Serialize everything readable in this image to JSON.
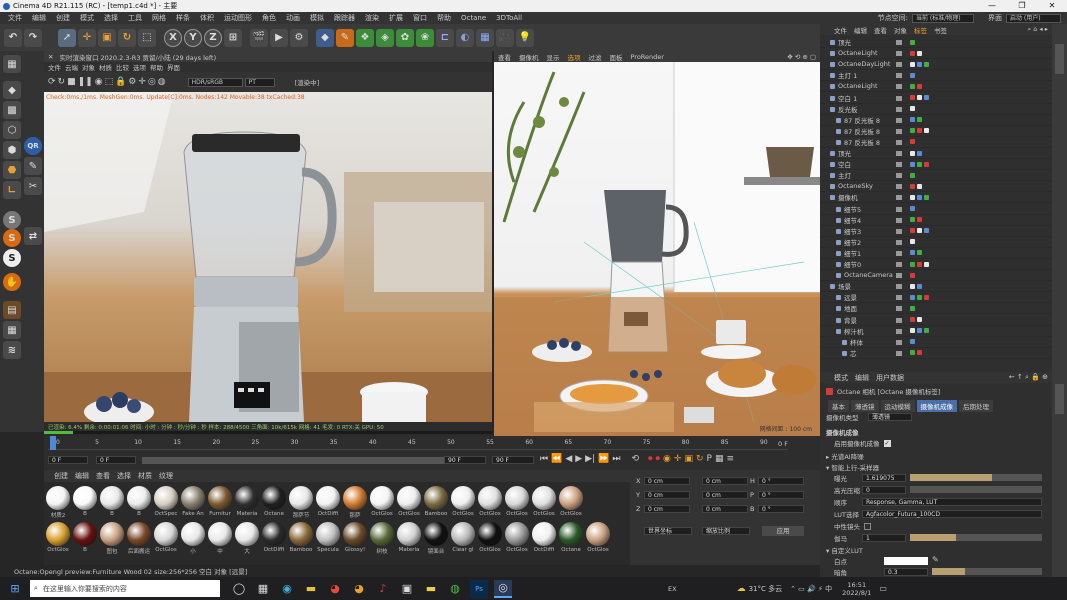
{
  "window": {
    "title": "Cinema 4D R21.115 (RC) - [temp1.c4d *] - 主要"
  },
  "menu": {
    "items": [
      "文件",
      "编辑",
      "创建",
      "模式",
      "选择",
      "工具",
      "网格",
      "样条",
      "体积",
      "运动图形",
      "角色",
      "动画",
      "模拟",
      "跟踪器",
      "渲染",
      "扩展",
      "窗口",
      "帮助",
      "Octane",
      "3DToAll"
    ],
    "node_space_label": "节点空间:",
    "node_space_value": "当前 (标准/物理)",
    "interface_label": "界面",
    "interface_value": "启动 (用户)"
  },
  "toolbar": {
    "axis_x": "X",
    "axis_y": "Y",
    "axis_z": "Z"
  },
  "left_tools": {
    "qr": "QR"
  },
  "live_viewer": {
    "title": "实时渲染窗口 2020.2.3-R3 贾留/小陆 (29 days left)",
    "menus": [
      "文件",
      "云端",
      "对象",
      "材质",
      "比较",
      "选项",
      "帮助",
      "界面"
    ],
    "colorspace": "HDR/sRGB",
    "mode": "PT",
    "status_tag": "[渲染中]",
    "info_line": "Check:0ms./1ms. MeshGen:0ms. Update[C]:0ms. Nodes:142 Movable:38 txCached:38",
    "stats_line": "已渲染: 6.4%  剩余: 0:00:01:06  时间: 小时 : 分钟 : 秒/分钟 : 秒  样本: 288/4500  三角面: 10k/615k  网格: 41  毛发: 0  RTX:关  GPU: 50",
    "progress": 0.064
  },
  "editor_viewport": {
    "menus": [
      "查看",
      "摄像机",
      "显示",
      "选项",
      "过滤",
      "面板",
      "ProRender"
    ],
    "grid_info": "网格间距 : 100 cm"
  },
  "timeline": {
    "ticks": [
      "0",
      "5",
      "10",
      "15",
      "20",
      "25",
      "30",
      "35",
      "40",
      "45",
      "50",
      "55",
      "60",
      "65",
      "70",
      "75",
      "80",
      "85",
      "90"
    ],
    "end_label": "0 F",
    "current_frame": "0 F",
    "start_field": "0 F",
    "end_field": "90 F",
    "end_field2": "90 F"
  },
  "material_manager": {
    "menus": [
      "创建",
      "编辑",
      "查看",
      "选择",
      "材质",
      "纹理"
    ],
    "row1": [
      "材质2",
      "B",
      "B",
      "B",
      "OctSpec",
      "Fake An",
      "Furnitur",
      "Materia",
      "Octane",
      "那萨节",
      "OctDiffi",
      "那萨",
      "OctGlos",
      "OctGlos",
      "Bamboo",
      "OctGlos",
      "OctGlos",
      "OctGlos",
      "OctGlos",
      "OctGlos"
    ],
    "row2": [
      "OctGlos",
      "B",
      "图包",
      "后面搬运",
      "OctGlos",
      "小",
      "中",
      "大",
      "OctDiffi",
      "Bamboo",
      "Specula",
      "Glossy!",
      "树枝",
      "Materia",
      "镜面台",
      "Clear gl",
      "OctGlos",
      "OctGlos",
      "OctDiffi",
      "Octane",
      "OctGlos"
    ]
  },
  "coordinates": {
    "x": "0 cm",
    "y": "0 cm",
    "z": "0 cm",
    "x2": "0 cm",
    "y2": "0 cm",
    "z2": "0 cm",
    "h": "0 °",
    "p": "0 °",
    "b": "0 °",
    "mode1": "世界坐标",
    "mode2": "缩放比例",
    "apply": "应用",
    "labels": {
      "x": "X",
      "y": "Y",
      "z": "Z",
      "h": "H",
      "p": "P",
      "b": "B"
    }
  },
  "status_bar": {
    "text": "Octane:Opengl preview:Furniture Wood 02  size:256*256     空白 对象 [远景]"
  },
  "object_manager": {
    "menus": [
      "文件",
      "编辑",
      "查看",
      "对象",
      "标签",
      "书签"
    ],
    "rows": [
      {
        "label": "顶光",
        "indent": 1
      },
      {
        "label": "OctaneLight",
        "indent": 1
      },
      {
        "label": "OctaneDayLight",
        "indent": 1
      },
      {
        "label": "主灯 1",
        "indent": 1
      },
      {
        "label": "OctaneLight",
        "indent": 1
      },
      {
        "label": "空白 1",
        "indent": 1
      },
      {
        "label": "反光板",
        "indent": 1
      },
      {
        "label": "87 反光板 8",
        "indent": 2
      },
      {
        "label": "87 反光板 8",
        "indent": 2
      },
      {
        "label": "87 反光板 8",
        "indent": 2
      },
      {
        "label": "顶光",
        "indent": 1
      },
      {
        "label": "空白",
        "indent": 1
      },
      {
        "label": "主灯",
        "indent": 1
      },
      {
        "label": "OctaneSky",
        "indent": 1
      },
      {
        "label": "摄像机",
        "indent": 1
      },
      {
        "label": "细节5",
        "indent": 2
      },
      {
        "label": "细节4",
        "indent": 2
      },
      {
        "label": "细节3",
        "indent": 2
      },
      {
        "label": "细节2",
        "indent": 2
      },
      {
        "label": "细节1",
        "indent": 2
      },
      {
        "label": "细节0",
        "indent": 2
      },
      {
        "label": "OctaneCamera",
        "indent": 2
      },
      {
        "label": "场景",
        "indent": 1
      },
      {
        "label": "远景",
        "indent": 2
      },
      {
        "label": "地面",
        "indent": 2
      },
      {
        "label": "背景",
        "indent": 2
      },
      {
        "label": "榨汁机",
        "indent": 2
      },
      {
        "label": "杯体",
        "indent": 3
      },
      {
        "label": "芯",
        "indent": 3
      }
    ]
  },
  "attribute_manager": {
    "menus": [
      "模式",
      "编辑",
      "用户数据"
    ],
    "title": "Octane 相机 [Octane 摄像机标签]",
    "tabs": [
      "基本",
      "薄透镜",
      "运动模糊",
      "摄像机成像",
      "后期处理"
    ],
    "camera_type_label": "摄像机类型",
    "camera_type_value": "薄透镜",
    "section": "摄像机成像",
    "enable_label": "启用摄像机成像",
    "group1": "▸ 光谱AI降噪",
    "group2": "▾ 智能上行-采样器",
    "exposure_label": "曝光",
    "exposure_value": "1.619075",
    "highlight_label": "高光压缩",
    "highlight_value": "0",
    "order_label": "顺序",
    "order_value": "Response, Gamma, LUT",
    "lut_label": "LUT选择",
    "lut_value": "Agfacolor_Futura_100CD",
    "neutral_label": "中性镜头",
    "gamma_label": "伽马",
    "gamma_value": "1",
    "custom_group": "▾ 自定义LUT",
    "white_label": "白点",
    "vignette_label": "暗角",
    "vignette_value": "0.3",
    "exposure_fill": 0.62,
    "gamma_fill": 0.35,
    "vignette_fill": 0.3
  },
  "taskbar": {
    "search_placeholder": "在这里输入你要搜索的内容",
    "weather": "31°C 多云",
    "time": "16:51",
    "date": "2022/8/1",
    "ime": "EX"
  }
}
